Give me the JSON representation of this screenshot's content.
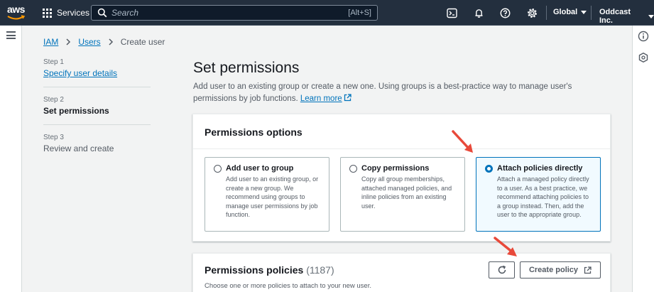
{
  "topnav": {
    "logo_text": "aws",
    "services_label": "Services",
    "search_placeholder": "Search",
    "search_shortcut": "[Alt+S]",
    "region_label": "Global",
    "account_label": "Oddcast Inc.",
    "icons": [
      "cloudshell-icon",
      "bell-icon",
      "help-icon",
      "gear-icon"
    ]
  },
  "breadcrumb": {
    "items": [
      "IAM",
      "Users"
    ],
    "current": "Create user"
  },
  "steps": [
    {
      "num": "Step 1",
      "label": "Specify user details",
      "state": "link"
    },
    {
      "num": "Step 2",
      "label": "Set permissions",
      "state": "current"
    },
    {
      "num": "Step 3",
      "label": "Review and create",
      "state": "upcoming"
    }
  ],
  "main": {
    "title": "Set permissions",
    "description": "Add user to an existing group or create a new one. Using groups is a best-practice way to manage user's permissions by job functions.",
    "learn_more": "Learn more"
  },
  "permissions_options": {
    "header": "Permissions options",
    "options": [
      {
        "title": "Add user to group",
        "description": "Add user to an existing group, or create a new group. We recommend using groups to manage user permissions by job function.",
        "selected": false
      },
      {
        "title": "Copy permissions",
        "description": "Copy all group memberships, attached managed policies, and inline policies from an existing user.",
        "selected": false
      },
      {
        "title": "Attach policies directly",
        "description": "Attach a managed policy directly to a user. As a best practice, we recommend attaching policies to a group instead. Then, add the user to the appropriate group.",
        "selected": true
      }
    ]
  },
  "permissions_policies": {
    "title": "Permissions policies",
    "count": "(1187)",
    "subtitle": "Choose one or more policies to attach to your new user.",
    "create_policy_label": "Create policy"
  },
  "colors": {
    "nav_bg": "#232f3e",
    "link": "#0073bb",
    "selected_bg": "#f1faff",
    "arrow": "#e8493a"
  }
}
